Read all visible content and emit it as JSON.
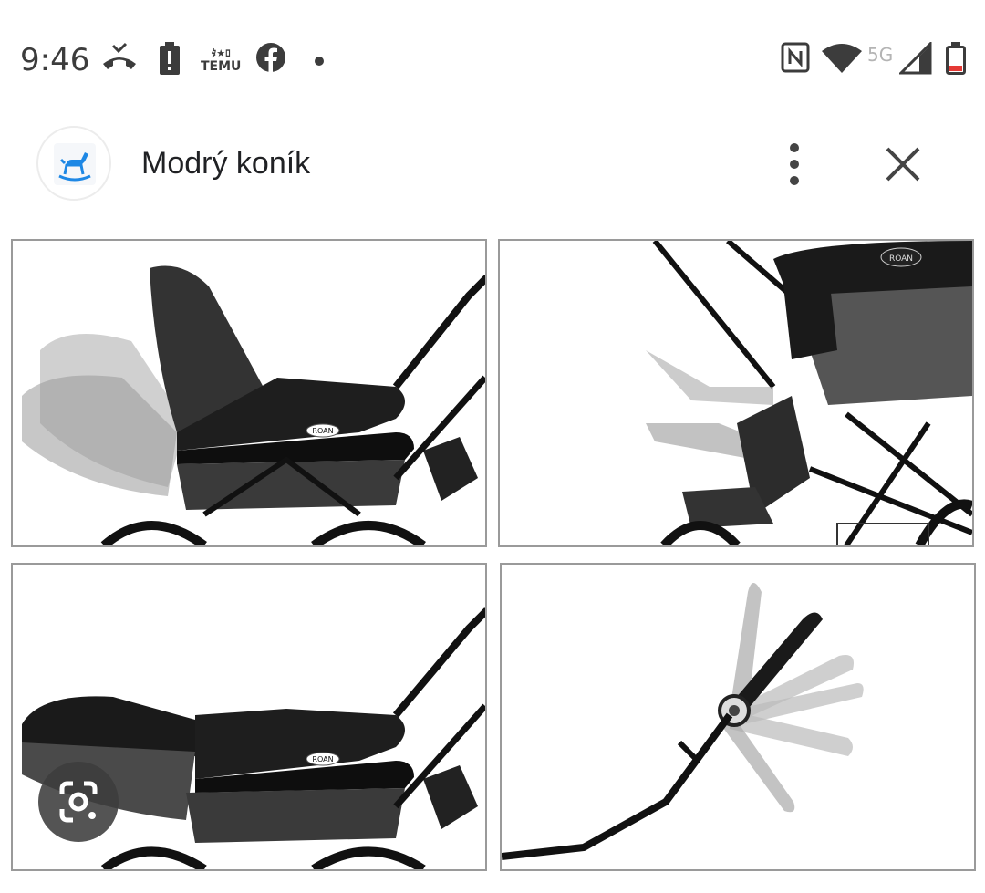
{
  "status_bar": {
    "time": "9:46",
    "temu_label": "TEMU",
    "network_label": "5G",
    "icons": [
      "missed-call-icon",
      "battery-alert-icon",
      "temu-app-icon",
      "facebook-icon",
      "notification-dot-icon",
      "nfc-icon",
      "wifi-icon",
      "signal-icon",
      "battery-low-icon"
    ]
  },
  "header": {
    "site_name": "Modrý koník",
    "favicon": "rocking-horse-icon",
    "more_icon": "more-vert-icon",
    "close_icon": "close-icon"
  },
  "images": [
    {
      "name": "stroller-backrest-reclining",
      "brand_text": "ROAN"
    },
    {
      "name": "stroller-footrest-adjusting",
      "brand_text": "ROAN"
    },
    {
      "name": "stroller-seat-flat-position",
      "brand_text": "ROAN"
    },
    {
      "name": "stroller-handle-adjusting",
      "brand_text": ""
    }
  ],
  "lens_button": {
    "icon": "google-lens-icon"
  },
  "colors": {
    "accent": "#1a73e8",
    "favicon_blue": "#1e88e5",
    "battery_low": "#e53935"
  }
}
